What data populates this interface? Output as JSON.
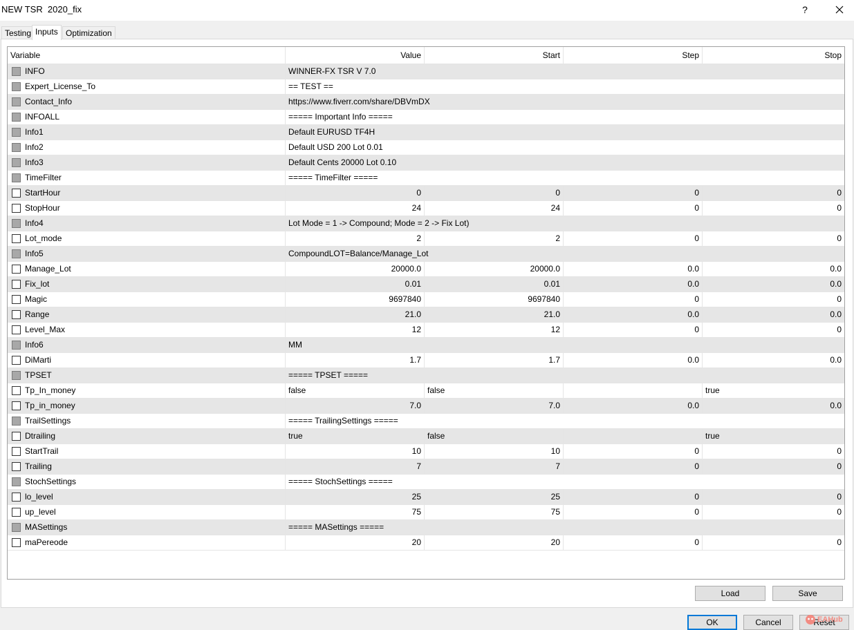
{
  "window": {
    "title": "NEW TSR  2020_fix",
    "help_glyph": "?",
    "close_icon": "close-icon"
  },
  "tabs": [
    "Testing",
    "Inputs",
    "Optimization"
  ],
  "active_tab": "Inputs",
  "grid": {
    "columns": [
      "Variable",
      "Value",
      "Start",
      "Step",
      "Stop"
    ],
    "rows": [
      {
        "variable": "INFO",
        "value": "WINNER-FX TSR V 7.0",
        "kind": "string"
      },
      {
        "variable": "Expert_License_To",
        "value": "== TEST ==",
        "kind": "string"
      },
      {
        "variable": "Contact_Info",
        "value": "https://www.fiverr.com/share/DBVmDX",
        "kind": "string"
      },
      {
        "variable": "INFOALL",
        "value": "===== Important Info =====",
        "kind": "string"
      },
      {
        "variable": "Info1",
        "value": "Default EURUSD TF4H",
        "kind": "string"
      },
      {
        "variable": "Info2",
        "value": "Default USD 200 Lot 0.01",
        "kind": "string"
      },
      {
        "variable": "Info3",
        "value": "Default Cents 20000 Lot 0.10",
        "kind": "string"
      },
      {
        "variable": "TimeFilter",
        "value": "===== TimeFilter =====",
        "kind": "string"
      },
      {
        "variable": "StartHour",
        "value": "0",
        "start": "0",
        "step": "0",
        "stop": "0",
        "kind": "number"
      },
      {
        "variable": "StopHour",
        "value": "24",
        "start": "24",
        "step": "0",
        "stop": "0",
        "kind": "number"
      },
      {
        "variable": "Info4",
        "value": "Lot Mode = 1 -> Compound; Mode = 2 -> Fix Lot)",
        "kind": "string"
      },
      {
        "variable": "Lot_mode",
        "value": "2",
        "start": "2",
        "step": "0",
        "stop": "0",
        "kind": "number"
      },
      {
        "variable": "Info5",
        "value": "CompoundLOT=Balance/Manage_Lot",
        "kind": "string"
      },
      {
        "variable": "Manage_Lot",
        "value": "20000.0",
        "start": "20000.0",
        "step": "0.0",
        "stop": "0.0",
        "kind": "number"
      },
      {
        "variable": "Fix_lot",
        "value": "0.01",
        "start": "0.01",
        "step": "0.0",
        "stop": "0.0",
        "kind": "number"
      },
      {
        "variable": "Magic",
        "value": "9697840",
        "start": "9697840",
        "step": "0",
        "stop": "0",
        "kind": "number"
      },
      {
        "variable": "Range",
        "value": "21.0",
        "start": "21.0",
        "step": "0.0",
        "stop": "0.0",
        "kind": "number"
      },
      {
        "variable": "Level_Max",
        "value": "12",
        "start": "12",
        "step": "0",
        "stop": "0",
        "kind": "number"
      },
      {
        "variable": "Info6",
        "value": "MM",
        "kind": "string"
      },
      {
        "variable": "DiMarti",
        "value": "1.7",
        "start": "1.7",
        "step": "0.0",
        "stop": "0.0",
        "kind": "number"
      },
      {
        "variable": "TPSET",
        "value": "===== TPSET =====",
        "kind": "string"
      },
      {
        "variable": "Tp_In_money",
        "value": "false",
        "start": "false",
        "step": "",
        "stop": "true",
        "kind": "bool"
      },
      {
        "variable": "Tp_in_money",
        "value": "7.0",
        "start": "7.0",
        "step": "0.0",
        "stop": "0.0",
        "kind": "number"
      },
      {
        "variable": "TrailSettings",
        "value": "===== TrailingSettings =====",
        "kind": "string"
      },
      {
        "variable": "Dtrailing",
        "value": "true",
        "start": "false",
        "step": "",
        "stop": "true",
        "kind": "bool"
      },
      {
        "variable": "StartTrail",
        "value": "10",
        "start": "10",
        "step": "0",
        "stop": "0",
        "kind": "number"
      },
      {
        "variable": "Trailing",
        "value": "7",
        "start": "7",
        "step": "0",
        "stop": "0",
        "kind": "number"
      },
      {
        "variable": "StochSettings",
        "value": "===== StochSettings =====",
        "kind": "string"
      },
      {
        "variable": "lo_level",
        "value": "25",
        "start": "25",
        "step": "0",
        "stop": "0",
        "kind": "number"
      },
      {
        "variable": "up_level",
        "value": "75",
        "start": "75",
        "step": "0",
        "stop": "0",
        "kind": "number"
      },
      {
        "variable": "MASettings",
        "value": "===== MASettings =====",
        "kind": "string"
      },
      {
        "variable": "maPereode",
        "value": "20",
        "start": "20",
        "step": "0",
        "stop": "0",
        "kind": "number"
      }
    ]
  },
  "buttons": {
    "load": "Load",
    "save": "Save",
    "ok": "OK",
    "cancel": "Cancel",
    "reset": "Reset"
  },
  "watermark": {
    "text": "EAHub",
    "color": "#f28b82"
  }
}
